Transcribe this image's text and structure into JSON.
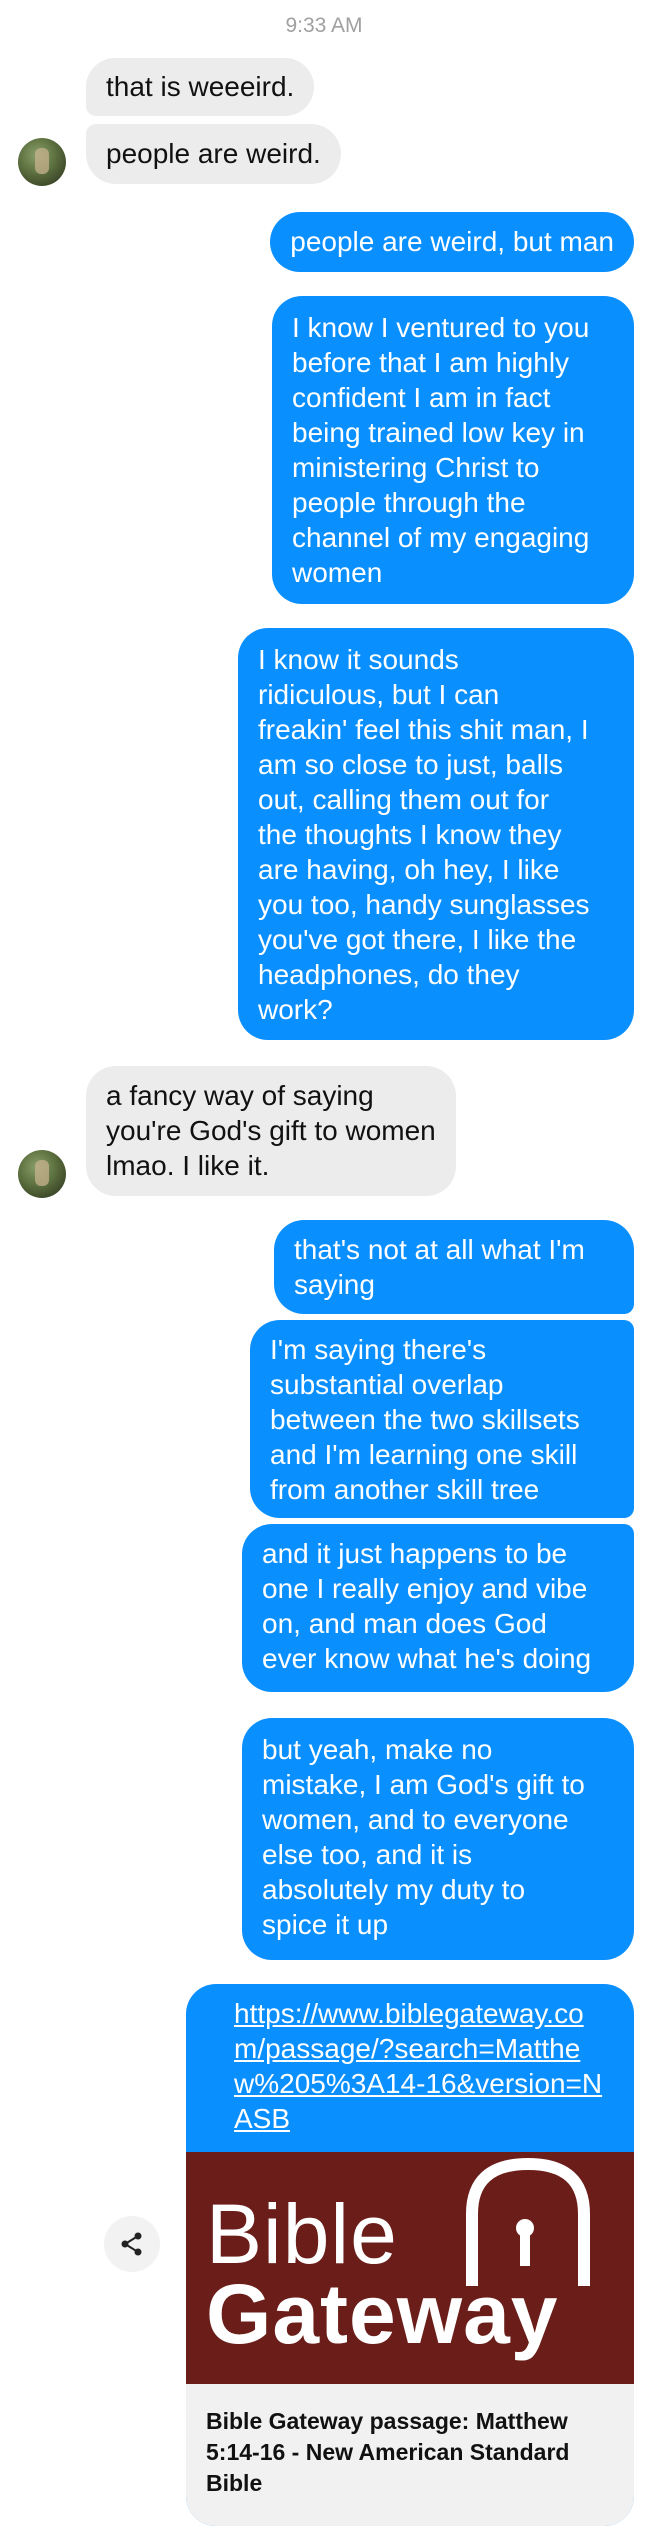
{
  "status": {
    "time": "9:33 AM"
  },
  "messages": [
    {
      "dir": "in",
      "text": "that is weeeird."
    },
    {
      "dir": "in",
      "text": "people are weird."
    },
    {
      "dir": "out",
      "text": "people are weird, but man"
    },
    {
      "dir": "out",
      "text": "I know I ventured to you\nbefore that I am highly\nconfident I am in fact\nbeing trained low key in\nministering Christ to\npeople through the\nchannel of my engaging\nwomen"
    },
    {
      "dir": "out",
      "text": "I know it sounds\nridiculous, but I can\nfreakin' feel this shit man, I\nam so close to just, balls\nout, calling them out for\nthe thoughts I know they\nare having, oh hey, I like\nyou too, handy sunglasses\nyou've got there, I like the\nheadphones, do they\nwork?"
    },
    {
      "dir": "in",
      "text": "a fancy way of saying\nyou're God's gift to women\nlmao. I like it."
    },
    {
      "dir": "out",
      "text": "that's not at all what I'm\nsaying"
    },
    {
      "dir": "out",
      "text": "I'm saying there's\nsubstantial overlap\nbetween the two skillsets\nand I'm learning one skill\nfrom another skill tree"
    },
    {
      "dir": "out",
      "text": "and it just happens to be\none I really enjoy and vibe\non, and man does God\never know what he's doing"
    },
    {
      "dir": "out",
      "text": "but yeah, make no\nmistake, I am God's gift to\nwomen, and to everyone\nelse too, and it is\nabsolutely my duty to\nspice it up"
    }
  ],
  "link_preview": {
    "url": "https://www.biblegateway.com/passage/?search=Matthew%205%3A14-16&version=NASB",
    "brand_line1": "Bible",
    "brand_line2": "Gateway",
    "caption": "Bible Gateway passage: Matthew 5:14-16 - New American Standard Bible"
  },
  "icons": {
    "avatar": "contact-avatar",
    "share": "share-icon"
  },
  "colors": {
    "outgoing": "#0a8fff",
    "incoming": "#ececec",
    "preview_bg": "#6b1e19"
  }
}
